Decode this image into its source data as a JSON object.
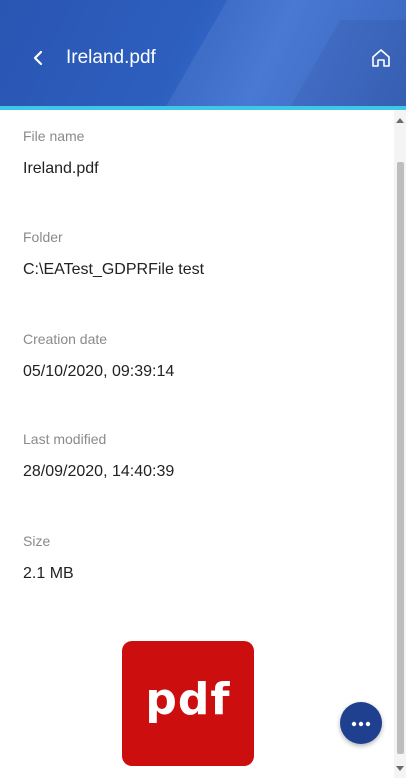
{
  "header": {
    "title": "Ireland.pdf",
    "back_icon": "chevron-left-icon",
    "home_icon": "home-icon",
    "background_color": "#2d5fbf",
    "accent_color": "#3fc7e8"
  },
  "details": {
    "file_name": {
      "label": "File name",
      "value": "Ireland.pdf"
    },
    "folder": {
      "label": "Folder",
      "value": "C:\\EATest_GDPRFile test"
    },
    "creation_date": {
      "label": "Creation date",
      "value": "05/10/2020, 09:39:14"
    },
    "last_modified": {
      "label": "Last modified",
      "value": "28/09/2020, 14:40:39"
    },
    "size": {
      "label": "Size",
      "value": "2.1 MB"
    }
  },
  "file_icon": {
    "text": "pdf",
    "color": "#cc0e0e"
  },
  "fab": {
    "icon": "more-horizontal-icon",
    "color": "#1f3f8f"
  }
}
